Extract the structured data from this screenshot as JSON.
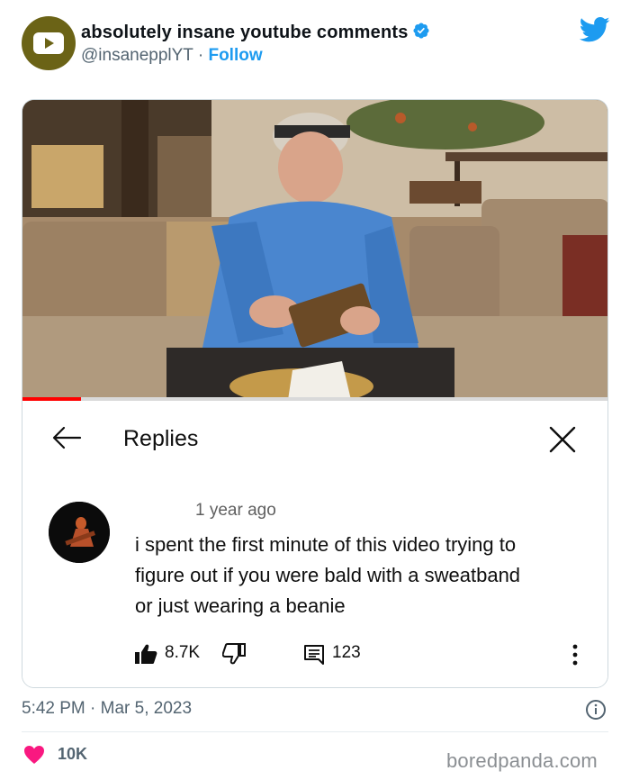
{
  "account": {
    "name": "absolutely insane youtube comments",
    "handle": "@insanepplYT",
    "separator": "·",
    "follow_label": "Follow",
    "verified": true
  },
  "colors": {
    "avatar": "#6b6316",
    "verified": "#1d9bf0",
    "twitter": "#1d9bf0",
    "heart": "#f91880",
    "progress": "#ff0000"
  },
  "video": {
    "progress_fraction": 0.1
  },
  "replies_panel": {
    "title": "Replies",
    "comment": {
      "time": "1 year ago",
      "lines": [
        "i spent the first minute of this video trying to",
        "figure out if you were bald with a sweatband",
        "or just wearing a beanie"
      ],
      "likes": "8.7K",
      "replies": "123"
    }
  },
  "tweet": {
    "timestamp": "5:42 PM · Mar 5, 2023",
    "likes": "10K"
  },
  "watermark": "boredpanda.com"
}
